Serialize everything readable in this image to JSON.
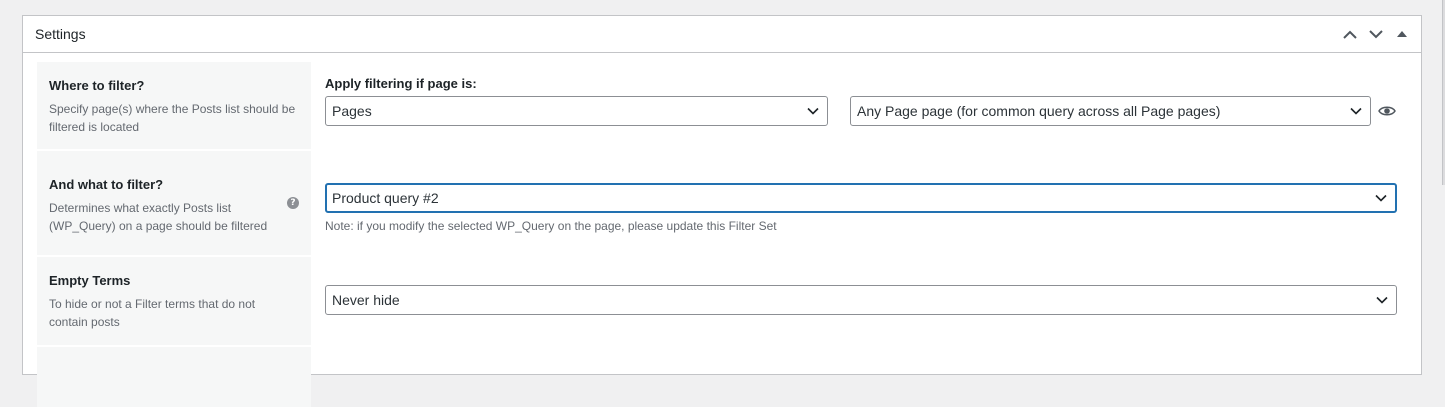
{
  "postbox": {
    "title": "Settings",
    "actions": {
      "up_icon": "chevron-up-icon",
      "down_icon": "chevron-down-icon",
      "toggle_icon": "triangle-up-icon"
    }
  },
  "rows": {
    "where": {
      "title": "Where to filter?",
      "description": "Specify page(s) where the Posts list should be filtered is located",
      "field_label": "Apply filtering if page is:",
      "select_type": "Pages",
      "select_page": "Any Page page (for common query across all Page pages)",
      "preview_icon": "eye-icon"
    },
    "what": {
      "title": "And what to filter?",
      "description": "Determines what exactly Posts list (WP_Query) on a page should be filtered",
      "help_icon": "?",
      "select_query": "Product query #2",
      "note": "Note: if you modify the selected WP_Query on the page, please update this Filter Set"
    },
    "empty_terms": {
      "title": "Empty Terms",
      "description": "To hide or not a Filter terms that do not contain posts",
      "select_value": "Never hide"
    }
  },
  "colors": {
    "focus_border": "#2271b1",
    "label_bg": "#f6f7f7",
    "border": "#c3c4c7"
  }
}
